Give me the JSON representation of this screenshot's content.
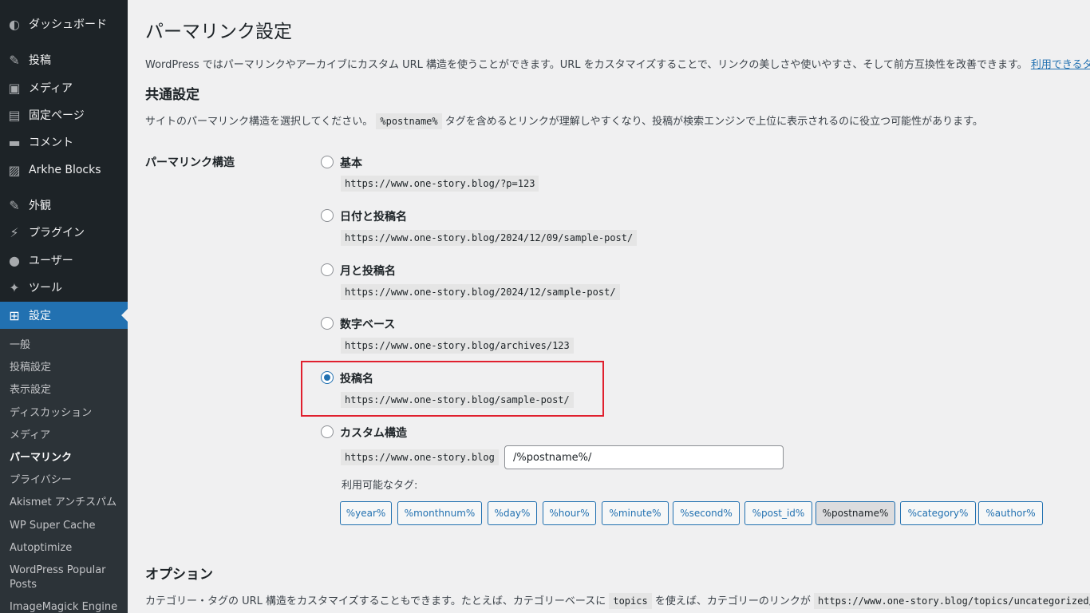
{
  "sidebar": {
    "items": [
      {
        "label": "ダッシュボード",
        "icon": "dashboard-icon",
        "glyph": "◐"
      },
      {
        "label": "投稿",
        "icon": "pin-icon",
        "glyph": "✎"
      },
      {
        "label": "メディア",
        "icon": "media-icon",
        "glyph": "▣"
      },
      {
        "label": "固定ページ",
        "icon": "pages-icon",
        "glyph": "▤"
      },
      {
        "label": "コメント",
        "icon": "comment-icon",
        "glyph": "▬"
      },
      {
        "label": "Arkhe Blocks",
        "icon": "blocks-icon",
        "glyph": "▨"
      },
      {
        "label": "外観",
        "icon": "appearance-icon",
        "glyph": "✎"
      },
      {
        "label": "プラグイン",
        "icon": "plugin-icon",
        "glyph": "⚡"
      },
      {
        "label": "ユーザー",
        "icon": "user-icon",
        "glyph": "●"
      },
      {
        "label": "ツール",
        "icon": "tools-icon",
        "glyph": "✦"
      },
      {
        "label": "設定",
        "icon": "settings-icon",
        "glyph": "⊞"
      }
    ],
    "submenu": [
      "一般",
      "投稿設定",
      "表示設定",
      "ディスカッション",
      "メディア",
      "パーマリンク",
      "プライバシー",
      "Akismet アンチスパム",
      "WP Super Cache",
      "Autoptimize",
      "WordPress Popular Posts",
      "ImageMagick Engine"
    ],
    "current_sub": "パーマリンク"
  },
  "main": {
    "title": "パーマリンク設定",
    "intro": "WordPress ではパーマリンクやアーカイブにカスタム URL 構造を使うことができます。URL をカスタマイズすることで、リンクの美しさや使いやすさ、そして前方互換性を改善できます。",
    "intro_link": "利用できるタグ",
    "common_heading": "共通設定",
    "common_desc_pre": "サイトのパーマリンク構造を選択してください。",
    "common_desc_code": "%postname%",
    "common_desc_post": "タグを含めるとリンクが理解しやすくなり、投稿が検索エンジンで上位に表示されるのに役立つ可能性があります。",
    "structure_label": "パーマリンク構造",
    "options": [
      {
        "label": "基本",
        "example": "https://www.one-story.blog/?p=123",
        "checked": false
      },
      {
        "label": "日付と投稿名",
        "example": "https://www.one-story.blog/2024/12/09/sample-post/",
        "checked": false
      },
      {
        "label": "月と投稿名",
        "example": "https://www.one-story.blog/2024/12/sample-post/",
        "checked": false
      },
      {
        "label": "数字ベース",
        "example": "https://www.one-story.blog/archives/123",
        "checked": false
      },
      {
        "label": "投稿名",
        "example": "https://www.one-story.blog/sample-post/",
        "checked": true
      },
      {
        "label": "カスタム構造",
        "example": "https://www.one-story.blog",
        "checked": false
      }
    ],
    "custom_value": "/%postname%/",
    "available_tags_label": "利用可能なタグ:",
    "tags": [
      "%year%",
      "%monthnum%",
      "%day%",
      "%hour%",
      "%minute%",
      "%second%",
      "%post_id%",
      "%postname%",
      "%category%",
      "%author%"
    ],
    "active_tag": "%postname%",
    "options_heading": "オプション",
    "options_desc_pre": "カテゴリー・タグの URL 構造をカスタマイズすることもできます。たとえば、カテゴリーベースに",
    "options_desc_code": "topics",
    "options_desc_mid": "を使えば、カテゴリーのリンクが",
    "options_desc_code2": "https://www.one-story.blog/topics/uncategorized/"
  },
  "colors": {
    "accent": "#2271b1",
    "sidebar": "#1d2327",
    "highlight": "#e0202e"
  }
}
